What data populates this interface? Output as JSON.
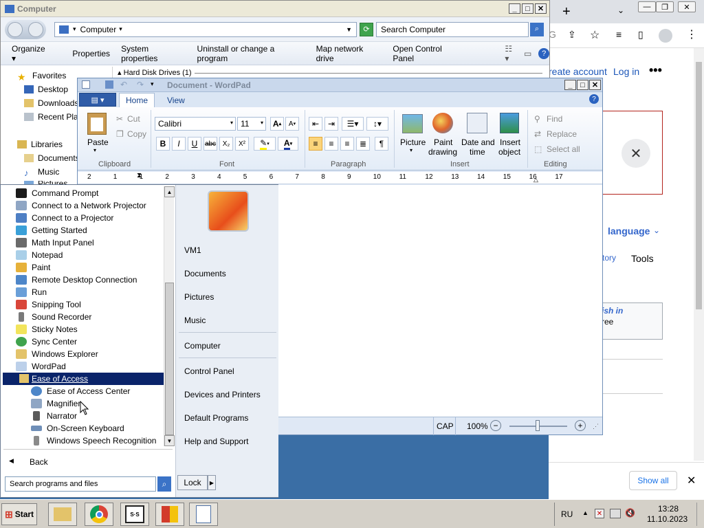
{
  "explorer": {
    "title": "Computer",
    "address": "Computer",
    "search_placeholder": "Search Computer",
    "commands": [
      "Organize",
      "Properties",
      "System properties",
      "Uninstall or change a program",
      "Map network drive",
      "Open Control Panel"
    ],
    "section_header": "Hard Disk Drives (1)",
    "nav": {
      "favorites": "Favorites",
      "desktop": "Desktop",
      "downloads": "Downloads",
      "recent": "Recent Plac",
      "libraries": "Libraries",
      "documents": "Documents",
      "music": "Music",
      "pictures": "Pictures"
    }
  },
  "wordpad": {
    "title": "Document - WordPad",
    "tabs": {
      "home": "Home",
      "view": "View"
    },
    "clipboard": {
      "paste": "Paste",
      "cut": "Cut",
      "copy": "Copy",
      "label": "Clipboard"
    },
    "font": {
      "name": "Calibri",
      "size": "11",
      "label": "Font",
      "bold": "B",
      "italic": "I",
      "underline": "U",
      "strike": "abc",
      "sub": "X₂",
      "sup": "X²"
    },
    "paragraph": {
      "label": "Paragraph"
    },
    "insert": {
      "picture": "Picture",
      "paint1": "Paint",
      "paint2": "drawing",
      "date1": "Date and",
      "date2": "time",
      "obj1": "Insert",
      "obj2": "object",
      "label": "Insert"
    },
    "editing": {
      "find": "Find",
      "replace": "Replace",
      "select_all": "Select all",
      "label": "Editing"
    },
    "ruler": [
      "2",
      "1",
      "1",
      "2",
      "3",
      "4",
      "5",
      "6",
      "7",
      "8",
      "9",
      "10",
      "11",
      "12",
      "13",
      "14",
      "15",
      "16",
      "17"
    ],
    "status": {
      "cap": "CAP",
      "zoom": "100%"
    }
  },
  "startmenu": {
    "programs": [
      "Command Prompt",
      "Connect to a Network Projector",
      "Connect to a Projector",
      "Getting Started",
      "Math Input Panel",
      "Notepad",
      "Paint",
      "Remote Desktop Connection",
      "Run",
      "Snipping Tool",
      "Sound Recorder",
      "Sticky Notes",
      "Sync Center",
      "Windows Explorer",
      "WordPad"
    ],
    "folder": "Ease of Access",
    "sub_programs": [
      "Ease of Access Center",
      "Magnifier",
      "Narrator",
      "On-Screen Keyboard",
      "Windows Speech Recognition"
    ],
    "back": "Back",
    "search_placeholder": "Search programs and files",
    "lock": "Lock",
    "right": {
      "user": "VM1",
      "documents": "Documents",
      "pictures": "Pictures",
      "music": "Music",
      "computer": "Computer",
      "control_panel": "Control Panel",
      "devices": "Devices and Printers",
      "default_programs": "Default Programs",
      "help": "Help and Support"
    }
  },
  "chrome": {
    "create_account": "reate account",
    "login": "Log in",
    "language": "language",
    "history": "story",
    "tools": "Tools",
    "notice1": "ish in",
    "notice2": "ree",
    "show_all": "Show all"
  },
  "taskbar": {
    "start": "Start",
    "lang": "RU",
    "time": "13:28",
    "date": "11.10.2023"
  }
}
